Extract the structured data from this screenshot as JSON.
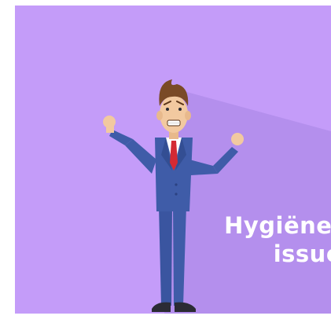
{
  "caption": {
    "line1": "Hygiëne-",
    "line2": "issue"
  },
  "colors": {
    "background": "#c49cf9",
    "shadow": "#b08be8",
    "suit": "#3f5ca8",
    "skin": "#f2c9a0",
    "hair": "#7a4a26",
    "tie": "#d42a34",
    "text": "#ffffff"
  },
  "icons": [
    "worried-businessman-illustration"
  ]
}
